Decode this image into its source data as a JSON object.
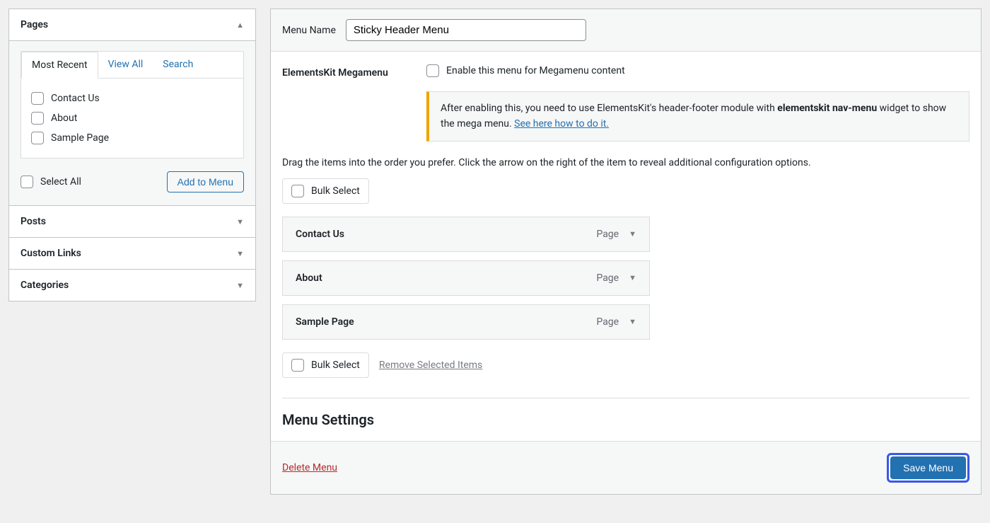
{
  "sidebar": {
    "pages_title": "Pages",
    "tabs": {
      "recent": "Most Recent",
      "view_all": "View All",
      "search": "Search"
    },
    "page_items": [
      "Contact Us",
      "About",
      "Sample Page"
    ],
    "select_all": "Select All",
    "add_to_menu": "Add to Menu",
    "posts_title": "Posts",
    "custom_links_title": "Custom Links",
    "categories_title": "Categories"
  },
  "main": {
    "menu_name_label": "Menu Name",
    "menu_name_value": "Sticky Header Menu",
    "mega_label": "ElementsKit Megamenu",
    "mega_enable_text": "Enable this menu for Megamenu content",
    "notice_a": "After enabling this, you need to use ElementsKit's header-footer module with ",
    "notice_bold": "elementskit nav-menu",
    "notice_b": " widget to show the mega menu. ",
    "notice_link": "See here how to do it.",
    "instructions": "Drag the items into the order you prefer. Click the arrow on the right of the item to reveal additional configuration options.",
    "bulk_select": "Bulk Select",
    "items": [
      {
        "name": "Contact Us",
        "type": "Page"
      },
      {
        "name": "About",
        "type": "Page"
      },
      {
        "name": "Sample Page",
        "type": "Page"
      }
    ],
    "remove_selected": "Remove Selected Items",
    "menu_settings_heading": "Menu Settings",
    "delete_menu": "Delete Menu",
    "save_menu": "Save Menu"
  }
}
